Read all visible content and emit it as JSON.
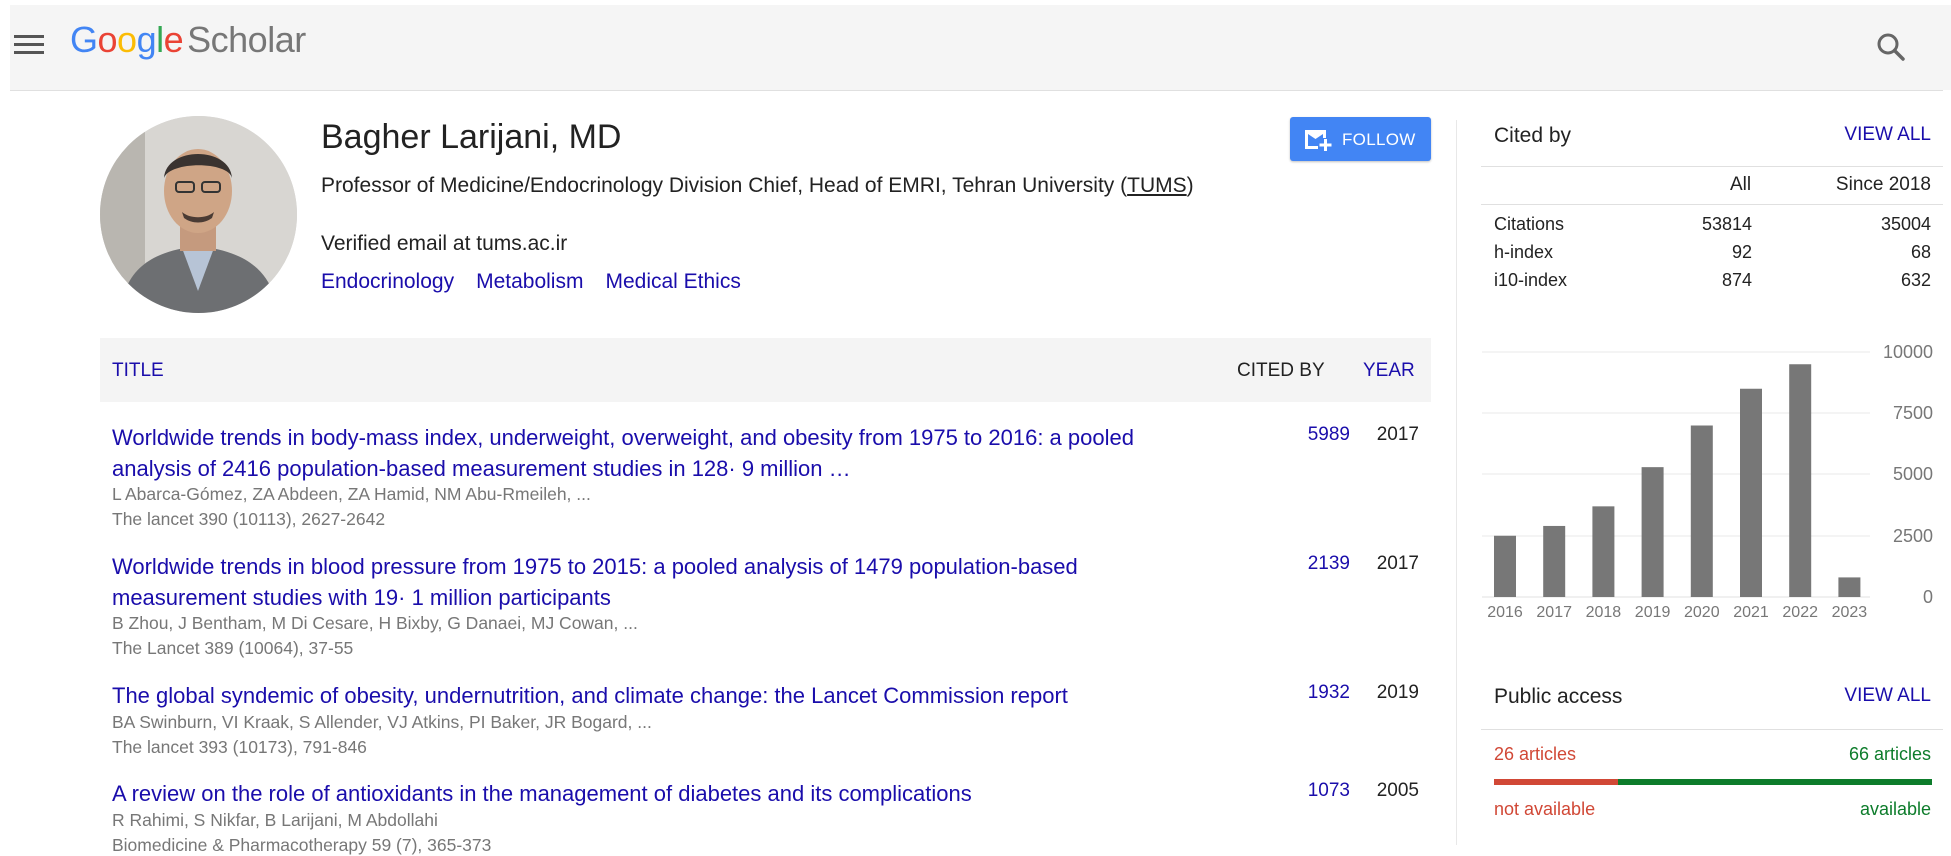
{
  "header": {
    "logo": {
      "letters": [
        "G",
        "o",
        "o",
        "g",
        "l",
        "e"
      ],
      "colors": [
        "#4285f4",
        "#ea4335",
        "#fbbc05",
        "#4285f4",
        "#34a853",
        "#ea4335"
      ],
      "product": "Scholar"
    },
    "menu_icon": "hamburger-menu-icon",
    "search_icon": "search-icon"
  },
  "profile": {
    "name": "Bagher Larijani, MD",
    "affiliation_main": "Professor of Medicine/Endocrinology Division Chief, Head of EMRI, Tehran University (",
    "affiliation_link": "TUMS",
    "affiliation_end": ")",
    "email": "Verified email at tums.ac.ir",
    "interests": [
      "Endocrinology",
      "Metabolism",
      "Medical Ethics"
    ],
    "follow_label": "FOLLOW"
  },
  "articles_table": {
    "headers": {
      "title": "TITLE",
      "cited_by": "CITED BY",
      "year": "YEAR"
    },
    "rows": [
      {
        "title": "Worldwide trends in body-mass index, underweight, overweight, and obesity from 1975 to 2016: a pooled analysis of 2416 population-based measurement studies in 128· 9 million …",
        "authors": "L Abarca-Gómez, ZA Abdeen, ZA Hamid, NM Abu-Rmeileh, ...",
        "venue": "The lancet 390 (10113), 2627-2642",
        "cited_by": "5989",
        "year": "2017"
      },
      {
        "title": "Worldwide trends in blood pressure from 1975 to 2015: a pooled analysis of 1479 population-based measurement studies with 19· 1 million participants",
        "authors": "B Zhou, J Bentham, M Di Cesare, H Bixby, G Danaei, MJ Cowan, ...",
        "venue": "The Lancet 389 (10064), 37-55",
        "cited_by": "2139",
        "year": "2017"
      },
      {
        "title": "The global syndemic of obesity, undernutrition, and climate change: the Lancet Commission report",
        "authors": "BA Swinburn, VI Kraak, S Allender, VJ Atkins, PI Baker, JR Bogard, ...",
        "venue": "The lancet 393 (10173), 791-846",
        "cited_by": "1932",
        "year": "2019"
      },
      {
        "title": "A review on the role of antioxidants in the management of diabetes and its complications",
        "authors": "R Rahimi, S Nikfar, B Larijani, M Abdollahi",
        "venue": "Biomedicine & Pharmacotherapy 59 (7), 365-373",
        "cited_by": "1073",
        "year": "2005"
      }
    ]
  },
  "cited_by": {
    "title": "Cited by",
    "view_all": "VIEW ALL",
    "columns": [
      "All",
      "Since 2018"
    ],
    "rows": [
      {
        "label": "Citations",
        "all": "53814",
        "since": "35004"
      },
      {
        "label": "h-index",
        "all": "92",
        "since": "68"
      },
      {
        "label": "i10-index",
        "all": "874",
        "since": "632"
      }
    ]
  },
  "chart_data": {
    "type": "bar",
    "categories": [
      "2016",
      "2017",
      "2018",
      "2019",
      "2020",
      "2021",
      "2022",
      "2023"
    ],
    "values": [
      2500,
      2900,
      3700,
      5300,
      7000,
      8500,
      9500,
      800
    ],
    "yticks": [
      "10000",
      "7500",
      "5000",
      "2500",
      "0"
    ],
    "ylim": [
      0,
      10000
    ],
    "bar_color": "#777777",
    "grid": true,
    "title": "",
    "xlabel": "",
    "ylabel": ""
  },
  "public_access": {
    "title": "Public access",
    "view_all": "VIEW ALL",
    "not_available_count": "26 articles",
    "available_count": "66 articles",
    "not_available_label": "not available",
    "available_label": "available",
    "not_available_fraction": 0.283,
    "colors": {
      "not_available": "#d14836",
      "available": "#0d7c2b"
    }
  }
}
